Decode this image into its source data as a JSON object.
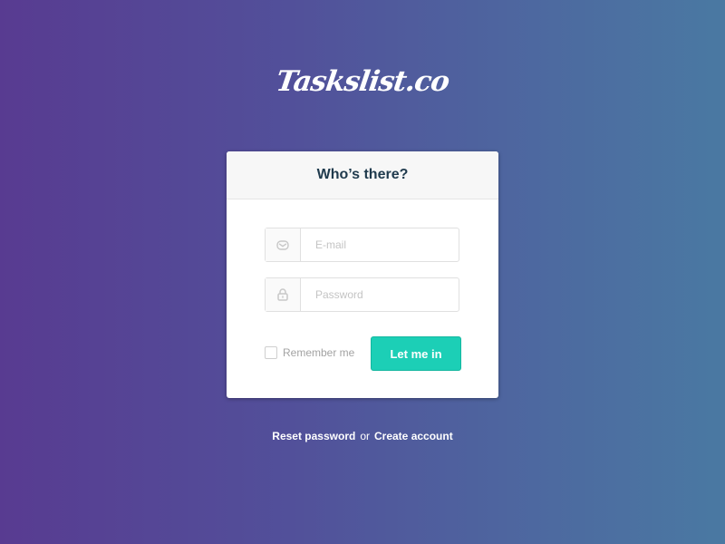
{
  "logo": {
    "text": "Taskslist.co"
  },
  "card": {
    "title": "Who’s there?"
  },
  "form": {
    "email": {
      "placeholder": "E-mail",
      "value": "",
      "icon": "email-icon"
    },
    "password": {
      "placeholder": "Password",
      "value": "",
      "icon": "lock-icon"
    },
    "remember_label": "Remember me",
    "remember_checked": false,
    "submit_label": "Let me in"
  },
  "footer": {
    "reset_label": "Reset password",
    "separator": "or",
    "create_label": "Create account"
  },
  "colors": {
    "accent": "#1ccfb6",
    "title_text": "#1f3a4d",
    "bg_left": "#583b91",
    "bg_right": "#4a79a2"
  }
}
